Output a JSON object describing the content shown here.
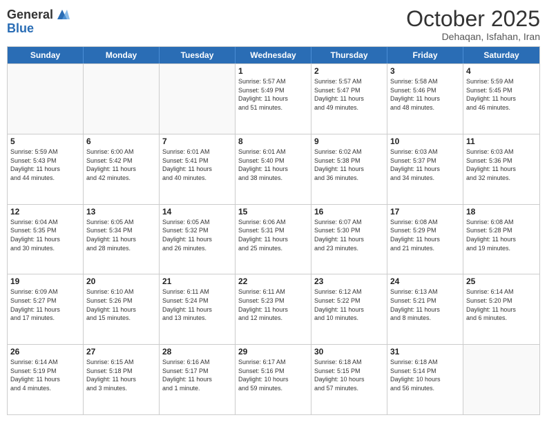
{
  "logo": {
    "general": "General",
    "blue": "Blue"
  },
  "title": "October 2025",
  "location": "Dehaqan, Isfahan, Iran",
  "weekdays": [
    "Sunday",
    "Monday",
    "Tuesday",
    "Wednesday",
    "Thursday",
    "Friday",
    "Saturday"
  ],
  "weeks": [
    [
      {
        "day": "",
        "info": ""
      },
      {
        "day": "",
        "info": ""
      },
      {
        "day": "",
        "info": ""
      },
      {
        "day": "1",
        "info": "Sunrise: 5:57 AM\nSunset: 5:49 PM\nDaylight: 11 hours\nand 51 minutes."
      },
      {
        "day": "2",
        "info": "Sunrise: 5:57 AM\nSunset: 5:47 PM\nDaylight: 11 hours\nand 49 minutes."
      },
      {
        "day": "3",
        "info": "Sunrise: 5:58 AM\nSunset: 5:46 PM\nDaylight: 11 hours\nand 48 minutes."
      },
      {
        "day": "4",
        "info": "Sunrise: 5:59 AM\nSunset: 5:45 PM\nDaylight: 11 hours\nand 46 minutes."
      }
    ],
    [
      {
        "day": "5",
        "info": "Sunrise: 5:59 AM\nSunset: 5:43 PM\nDaylight: 11 hours\nand 44 minutes."
      },
      {
        "day": "6",
        "info": "Sunrise: 6:00 AM\nSunset: 5:42 PM\nDaylight: 11 hours\nand 42 minutes."
      },
      {
        "day": "7",
        "info": "Sunrise: 6:01 AM\nSunset: 5:41 PM\nDaylight: 11 hours\nand 40 minutes."
      },
      {
        "day": "8",
        "info": "Sunrise: 6:01 AM\nSunset: 5:40 PM\nDaylight: 11 hours\nand 38 minutes."
      },
      {
        "day": "9",
        "info": "Sunrise: 6:02 AM\nSunset: 5:38 PM\nDaylight: 11 hours\nand 36 minutes."
      },
      {
        "day": "10",
        "info": "Sunrise: 6:03 AM\nSunset: 5:37 PM\nDaylight: 11 hours\nand 34 minutes."
      },
      {
        "day": "11",
        "info": "Sunrise: 6:03 AM\nSunset: 5:36 PM\nDaylight: 11 hours\nand 32 minutes."
      }
    ],
    [
      {
        "day": "12",
        "info": "Sunrise: 6:04 AM\nSunset: 5:35 PM\nDaylight: 11 hours\nand 30 minutes."
      },
      {
        "day": "13",
        "info": "Sunrise: 6:05 AM\nSunset: 5:34 PM\nDaylight: 11 hours\nand 28 minutes."
      },
      {
        "day": "14",
        "info": "Sunrise: 6:05 AM\nSunset: 5:32 PM\nDaylight: 11 hours\nand 26 minutes."
      },
      {
        "day": "15",
        "info": "Sunrise: 6:06 AM\nSunset: 5:31 PM\nDaylight: 11 hours\nand 25 minutes."
      },
      {
        "day": "16",
        "info": "Sunrise: 6:07 AM\nSunset: 5:30 PM\nDaylight: 11 hours\nand 23 minutes."
      },
      {
        "day": "17",
        "info": "Sunrise: 6:08 AM\nSunset: 5:29 PM\nDaylight: 11 hours\nand 21 minutes."
      },
      {
        "day": "18",
        "info": "Sunrise: 6:08 AM\nSunset: 5:28 PM\nDaylight: 11 hours\nand 19 minutes."
      }
    ],
    [
      {
        "day": "19",
        "info": "Sunrise: 6:09 AM\nSunset: 5:27 PM\nDaylight: 11 hours\nand 17 minutes."
      },
      {
        "day": "20",
        "info": "Sunrise: 6:10 AM\nSunset: 5:26 PM\nDaylight: 11 hours\nand 15 minutes."
      },
      {
        "day": "21",
        "info": "Sunrise: 6:11 AM\nSunset: 5:24 PM\nDaylight: 11 hours\nand 13 minutes."
      },
      {
        "day": "22",
        "info": "Sunrise: 6:11 AM\nSunset: 5:23 PM\nDaylight: 11 hours\nand 12 minutes."
      },
      {
        "day": "23",
        "info": "Sunrise: 6:12 AM\nSunset: 5:22 PM\nDaylight: 11 hours\nand 10 minutes."
      },
      {
        "day": "24",
        "info": "Sunrise: 6:13 AM\nSunset: 5:21 PM\nDaylight: 11 hours\nand 8 minutes."
      },
      {
        "day": "25",
        "info": "Sunrise: 6:14 AM\nSunset: 5:20 PM\nDaylight: 11 hours\nand 6 minutes."
      }
    ],
    [
      {
        "day": "26",
        "info": "Sunrise: 6:14 AM\nSunset: 5:19 PM\nDaylight: 11 hours\nand 4 minutes."
      },
      {
        "day": "27",
        "info": "Sunrise: 6:15 AM\nSunset: 5:18 PM\nDaylight: 11 hours\nand 3 minutes."
      },
      {
        "day": "28",
        "info": "Sunrise: 6:16 AM\nSunset: 5:17 PM\nDaylight: 11 hours\nand 1 minute."
      },
      {
        "day": "29",
        "info": "Sunrise: 6:17 AM\nSunset: 5:16 PM\nDaylight: 10 hours\nand 59 minutes."
      },
      {
        "day": "30",
        "info": "Sunrise: 6:18 AM\nSunset: 5:15 PM\nDaylight: 10 hours\nand 57 minutes."
      },
      {
        "day": "31",
        "info": "Sunrise: 6:18 AM\nSunset: 5:14 PM\nDaylight: 10 hours\nand 56 minutes."
      },
      {
        "day": "",
        "info": ""
      }
    ]
  ]
}
